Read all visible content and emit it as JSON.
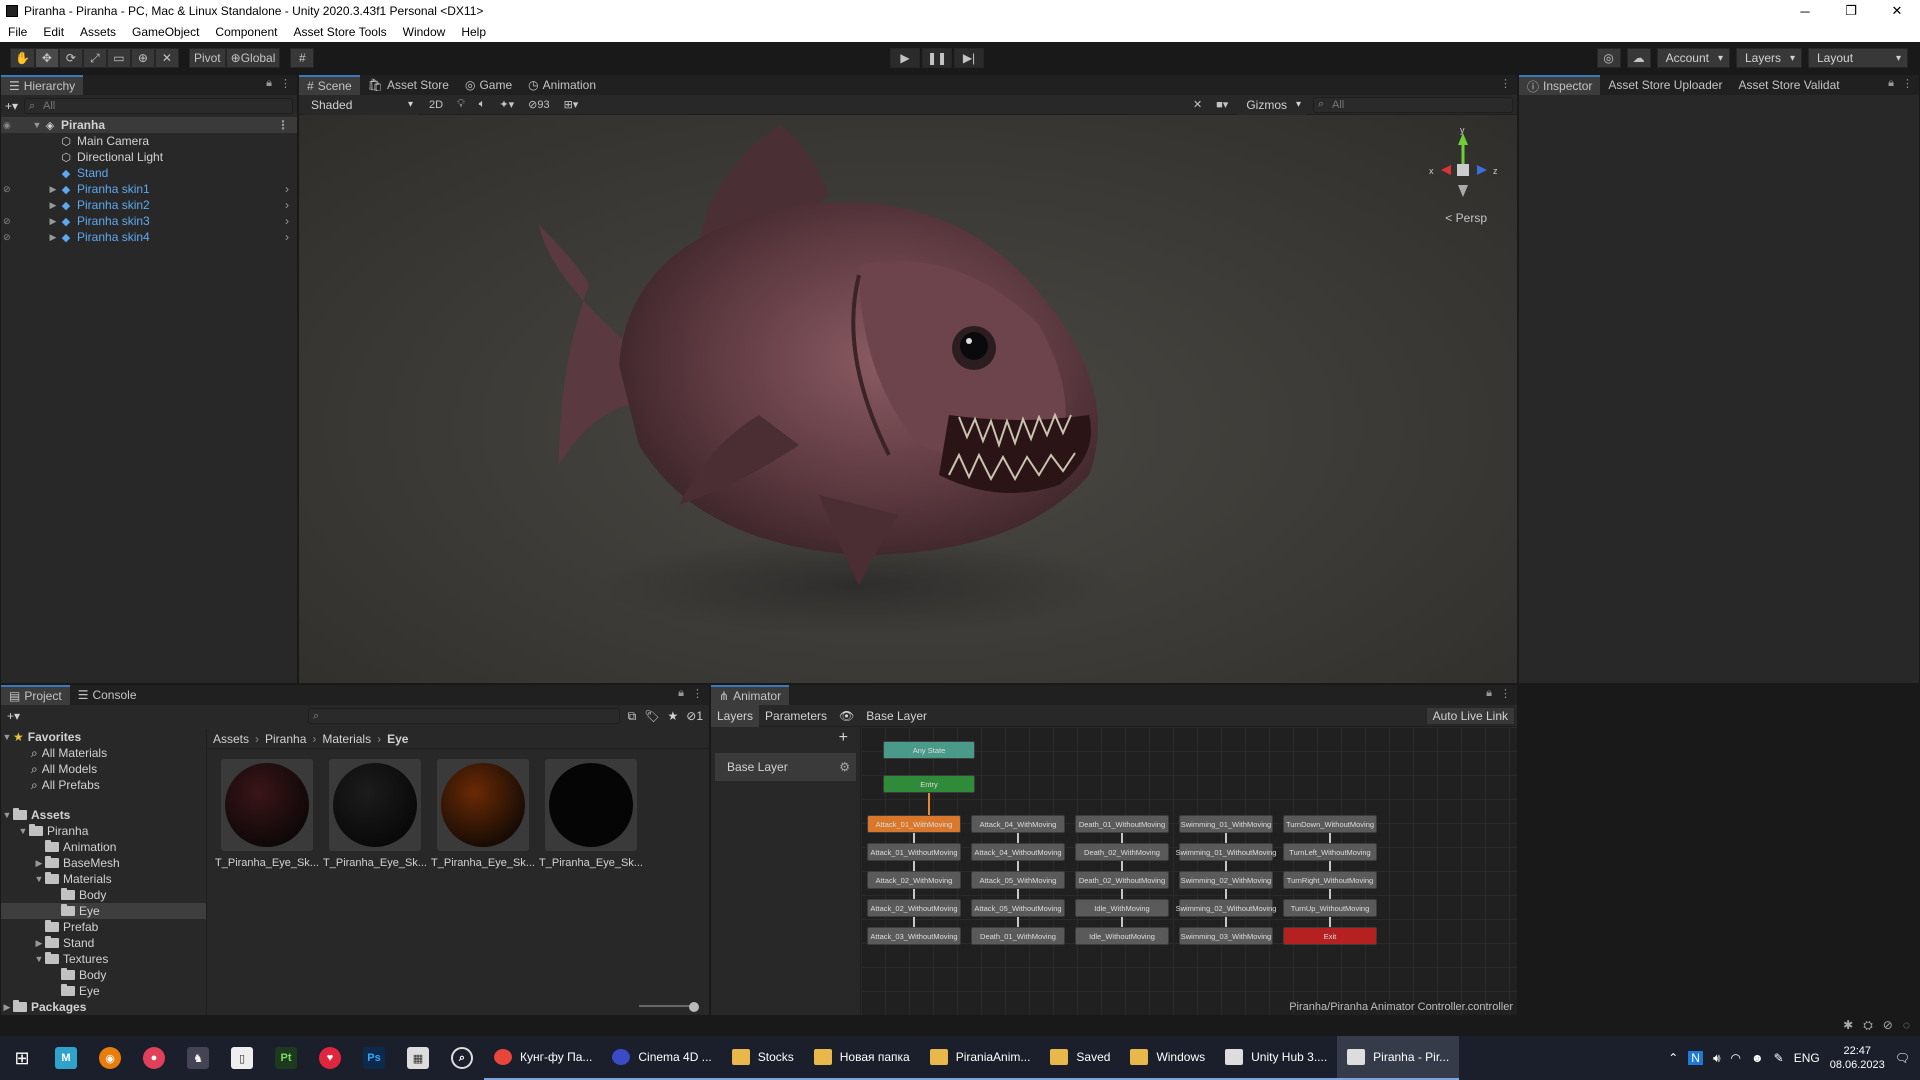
{
  "window": {
    "title": "Piranha - Piranha - PC, Mac & Linux Standalone - Unity 2020.3.43f1 Personal <DX11>",
    "minimize": "─",
    "restore": "❐",
    "close": "✕"
  },
  "menu": [
    "File",
    "Edit",
    "Assets",
    "GameObject",
    "Component",
    "Asset Store Tools",
    "Window",
    "Help"
  ],
  "toolbar": {
    "pivot": "Pivot",
    "global": "Global",
    "account": "Account",
    "layers": "Layers",
    "layout": "Layout"
  },
  "hierarchy": {
    "tab": "Hierarchy",
    "search_placeholder": "All",
    "root": "Piranha",
    "items": [
      {
        "label": "Main Camera",
        "prefab": false
      },
      {
        "label": "Directional Light",
        "prefab": false
      },
      {
        "label": "Stand",
        "prefab": true
      },
      {
        "label": "Piranha skin1",
        "prefab": true
      },
      {
        "label": "Piranha skin2",
        "prefab": true
      },
      {
        "label": "Piranha skin3",
        "prefab": true
      },
      {
        "label": "Piranha skin4",
        "prefab": true
      }
    ]
  },
  "scene": {
    "tabs": [
      "Scene",
      "Asset Store",
      "Game",
      "Animation"
    ],
    "shading": "Shaded",
    "mode_2d": "2D",
    "hidden_count": "93",
    "gizmos": "Gizmos",
    "search_placeholder": "All",
    "persp": "< Persp",
    "axis_x": "x",
    "axis_y": "y",
    "axis_z": "z"
  },
  "inspector": {
    "tabs": [
      "Inspector",
      "Asset Store Uploader",
      "Asset Store Validat"
    ]
  },
  "project": {
    "tabs": [
      "Project",
      "Console"
    ],
    "hidden_count": "1",
    "tree": {
      "favorites": "Favorites",
      "fav_items": [
        "All Materials",
        "All Models",
        "All Prefabs"
      ],
      "assets": "Assets",
      "piranha": "Piranha",
      "animation": "Animation",
      "basemesh": "BaseMesh",
      "materials": "Materials",
      "body": "Body",
      "eye": "Eye",
      "prefab": "Prefab",
      "stand": "Stand",
      "textures": "Textures",
      "tex_body": "Body",
      "tex_eye": "Eye",
      "packages": "Packages"
    },
    "breadcrumb": [
      "Assets",
      "Piranha",
      "Materials",
      "Eye"
    ],
    "assets": [
      {
        "label": "T_Piranha_Eye_Sk...",
        "color": "#3a1518"
      },
      {
        "label": "T_Piranha_Eye_Sk...",
        "color": "#1c1c1c"
      },
      {
        "label": "T_Piranha_Eye_Sk...",
        "color": "#6a2a05"
      },
      {
        "label": "T_Piranha_Eye_Sk...",
        "color": "#050505"
      }
    ]
  },
  "animator": {
    "tab": "Animator",
    "layers": "Layers",
    "parameters": "Parameters",
    "breadcrumb": "Base Layer",
    "live_link": "Auto Live Link",
    "layer_name": "Base Layer",
    "footer": "Piranha/Piranha Animator Controller.controller",
    "any_state": "Any State",
    "entry": "Entry",
    "states": [
      [
        "Attack_01_WithMoving",
        "Attack_01_WithoutMoving",
        "Attack_02_WithMoving",
        "Attack_02_WithoutMoving",
        "Attack_03_WithoutMoving"
      ],
      [
        "Attack_04_WithMoving",
        "Attack_04_WithoutMoving",
        "Attack_05_WithMoving",
        "Attack_05_WithoutMoving",
        "Death_01_WithMoving"
      ],
      [
        "Death_01_WithoutMoving",
        "Death_02_WithMoving",
        "Death_02_WithoutMoving",
        "Idle_WithMoving",
        "Idle_WithoutMoving"
      ],
      [
        "Swimming_01_WithMoving",
        "Swimming_01_WithoutMoving",
        "Swimming_02_WithMoving",
        "Swimming_02_WithoutMoving",
        "Swimming_03_WithMoving"
      ],
      [
        "TurnDown_WithoutMoving",
        "TurnLeft_WithoutMoving",
        "TurnRight_WithoutMoving",
        "TurnUp_WithoutMoving",
        "Exit"
      ]
    ]
  },
  "taskbar": {
    "apps": [
      {
        "label": "Кунг-фу Па...",
        "color": "#e8453c"
      },
      {
        "label": "Cinema 4D ...",
        "color": "#3b4bc8"
      },
      {
        "label": "Stocks",
        "color": "#e8b84a"
      },
      {
        "label": "Новая папка",
        "color": "#e8b84a"
      },
      {
        "label": "PiraniaAnim...",
        "color": "#e8b84a"
      },
      {
        "label": "Saved",
        "color": "#e8b84a"
      },
      {
        "label": "Windows",
        "color": "#e8b84a"
      },
      {
        "label": "Unity Hub 3....",
        "color": "#dddddd"
      },
      {
        "label": "Piranha - Pir...",
        "color": "#dddddd"
      }
    ],
    "lang": "ENG",
    "time": "22:47",
    "date": "08.06.2023"
  },
  "colors": {
    "accent": "#3a79bb",
    "prefab_blue": "#5ea8ef",
    "default_state": "#d9782a",
    "exit_state": "#b52020",
    "entry_state": "#2f8a3a"
  }
}
